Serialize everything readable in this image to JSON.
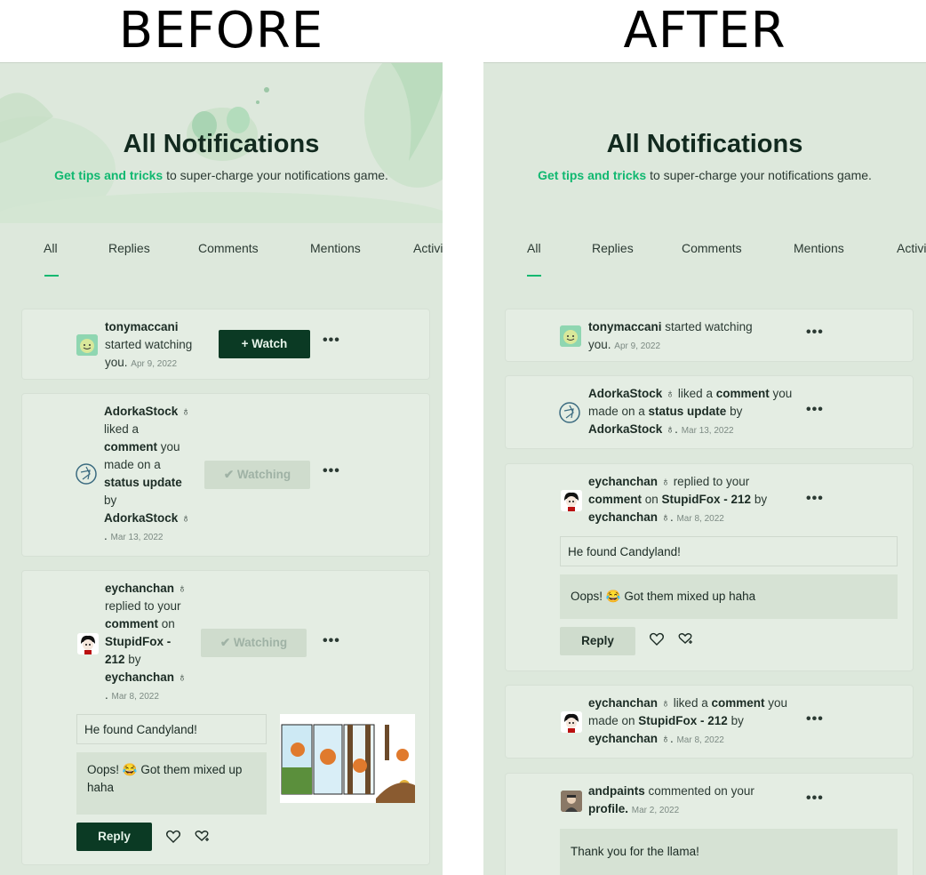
{
  "labels": {
    "before": "BEFORE",
    "after": "AFTER"
  },
  "header": {
    "title": "All Notifications",
    "tips_link": "Get tips and tricks",
    "tips_rest": " to super-charge your notifications game."
  },
  "tabs": [
    "All",
    "Replies",
    "Comments",
    "Mentions",
    "Activi"
  ],
  "before": {
    "n1": {
      "user": "tonymaccani",
      "line2": "started watching",
      "line3": "you.",
      "date": "Apr 9, 2022",
      "button": "+ Watch"
    },
    "n2": {
      "user": "AdorkaStock",
      "l2": "liked a",
      "l3_bold": "comment",
      "l3": " you",
      "l4": "made on a",
      "l5": "status update",
      "l6": "by",
      "l7": "AdorkaStock",
      "date": "Mar 13, 2022",
      "button": "✔ Watching"
    },
    "n3": {
      "user": "eychanchan",
      "l2": "replied to your",
      "l3_bold": "comment",
      "l3": " on",
      "l4": "StupidFox -",
      "l5_bold": "212",
      "l5": " by",
      "l6": "eychanchan",
      "date": "Mar 8, 2022",
      "button": "✔ Watching",
      "quote": "He found Candyland!",
      "reply": "Oops! 😂  Got them mixed up haha",
      "reply_button": "Reply"
    }
  },
  "after": {
    "n1": {
      "user": "tonymaccani",
      "action": " started watching",
      "line2": "you.",
      "date": "Apr 9, 2022"
    },
    "n2": {
      "user": "AdorkaStock",
      "action": " liked a ",
      "bold1": "comment",
      "rest1": " you",
      "line2a": "made on a ",
      "bold2": "status update",
      "line2b": " by",
      "line3": "AdorkaStock",
      "date": "Mar 13, 2022"
    },
    "n3": {
      "user": "eychanchan",
      "action": " replied to your",
      "bold1": "comment",
      "rest1": " on ",
      "bold2": "StupidFox - 212",
      "rest2": " by",
      "line3": "eychanchan",
      "date": "Mar 8, 2022",
      "quote": "He found Candyland!",
      "reply": "Oops! 😂  Got them mixed up haha",
      "reply_button": "Reply"
    },
    "n4": {
      "user": "eychanchan",
      "action": " liked a ",
      "bold1": "comment",
      "rest1": " you",
      "line2a": "made on ",
      "bold2": "StupidFox - 212",
      "line2b": " by",
      "line3": "eychanchan",
      "date": "Mar 8, 2022"
    },
    "n5": {
      "user": "andpaints",
      "action": " commented on your",
      "line2": "profile.",
      "date": "Mar 2, 2022",
      "reply": "Thank you for the llama!"
    }
  },
  "colors": {
    "accent": "#10b870",
    "dark_button": "#0b3a24",
    "panel_bg": "#dde8dc"
  }
}
